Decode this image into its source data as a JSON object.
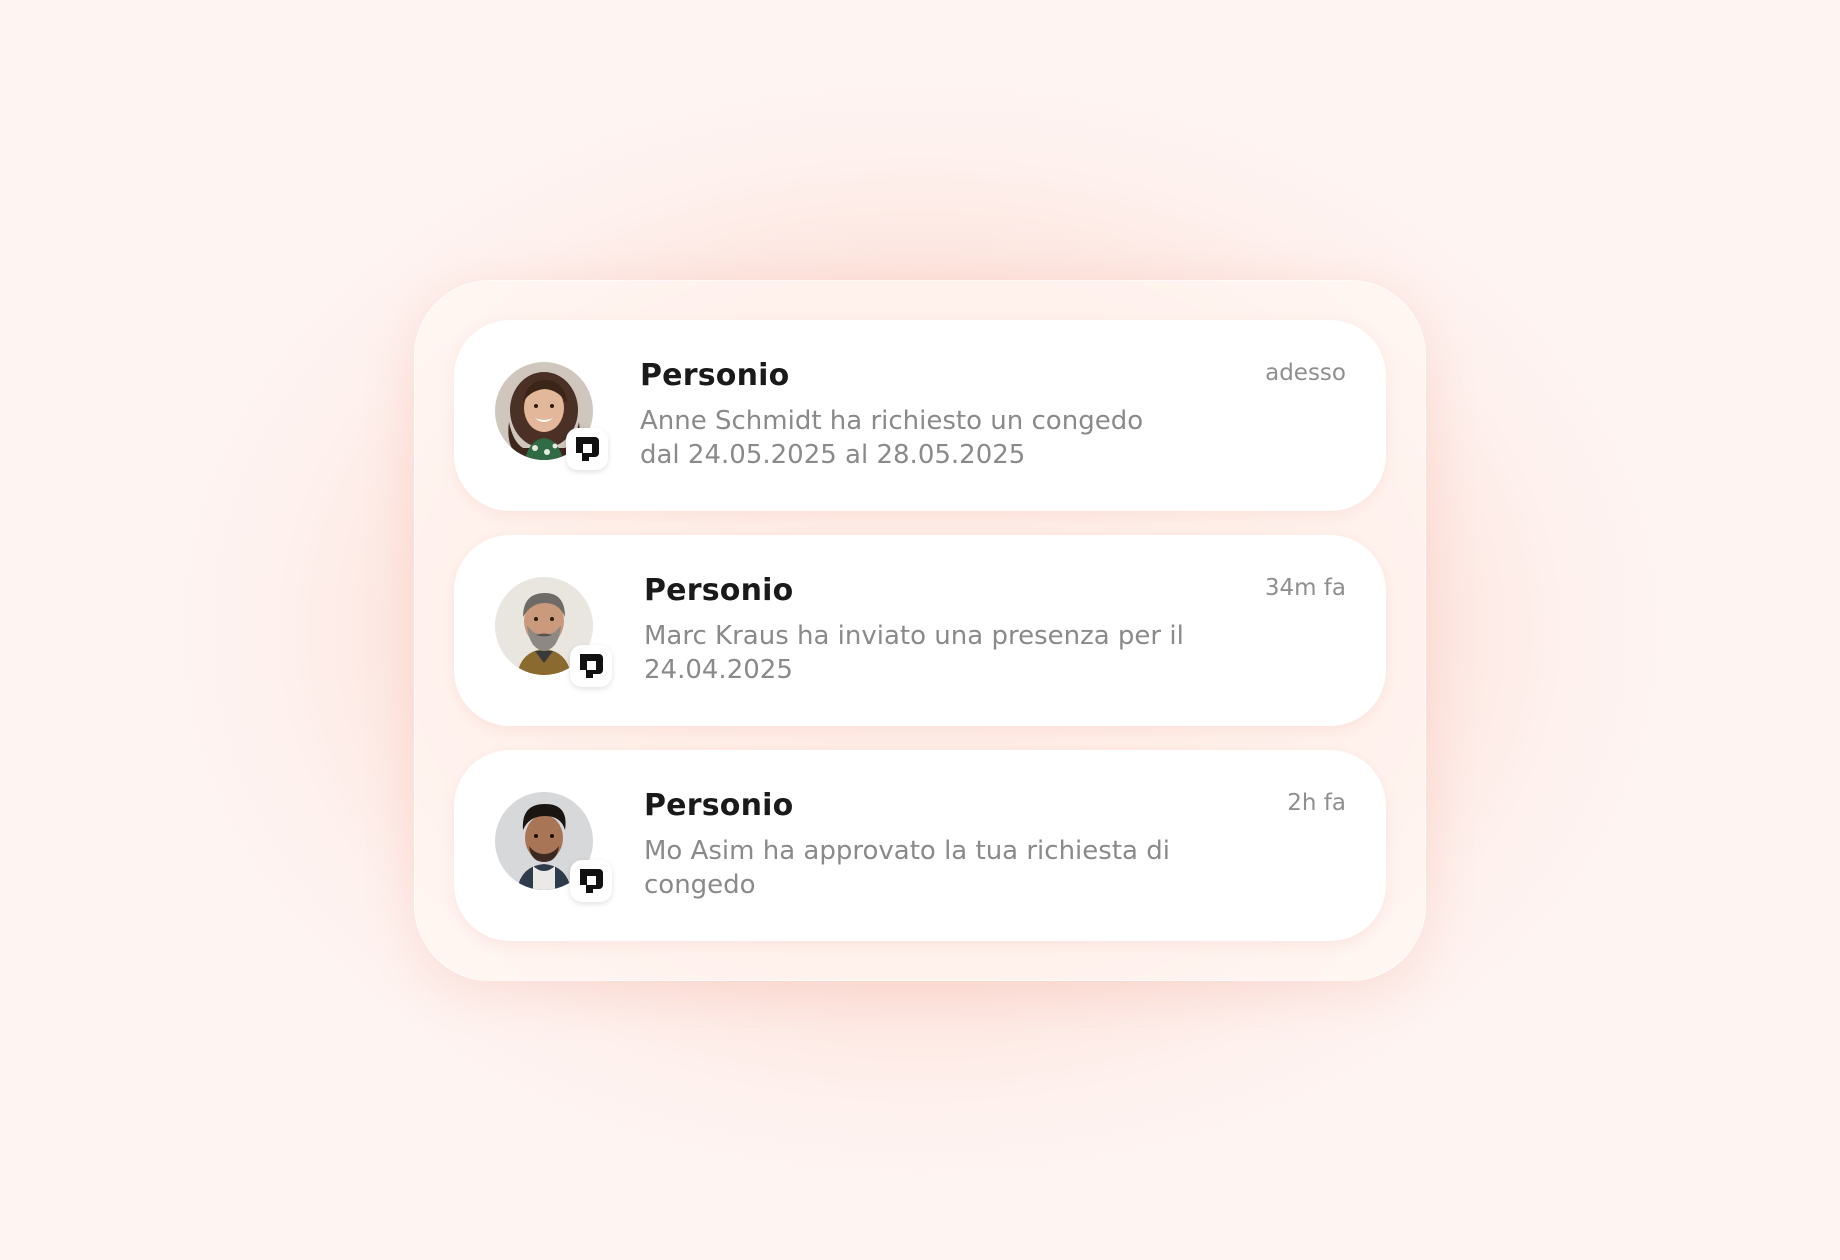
{
  "notifications": [
    {
      "app_name": "Personio",
      "message": "Anne Schmidt ha richiesto un congedo dal 24.05.2025 al 28.05.2025",
      "time": "adesso",
      "avatar_icon": "person-avatar-woman-curly-hair",
      "badge_icon": "personio-logo-icon"
    },
    {
      "app_name": "Personio",
      "message": "Marc Kraus ha inviato una presenza per il 24.04.2025",
      "time": "34m fa",
      "avatar_icon": "person-avatar-man-beard",
      "badge_icon": "personio-logo-icon"
    },
    {
      "app_name": "Personio",
      "message": "Mo Asim ha approvato la tua richiesta di congedo",
      "time": "2h fa",
      "avatar_icon": "person-avatar-man-dark-hair",
      "badge_icon": "personio-logo-icon"
    }
  ],
  "colors": {
    "background_center": "#fcc9be",
    "background_edge": "#fef4f2",
    "card": "#ffffff",
    "title_text": "#1a1a1a",
    "secondary_text": "#8a8a8a"
  }
}
